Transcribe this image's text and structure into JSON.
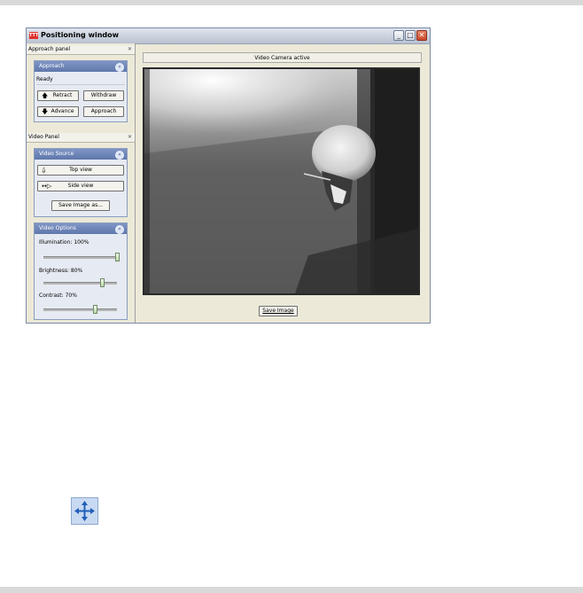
{
  "window": {
    "title": "Positioning window",
    "app_logo": "TTT",
    "minimize_label": "_",
    "maximize_label": "□",
    "close_label": "✕"
  },
  "approach_panel": {
    "title": "Approach panel",
    "close": "✕",
    "group_title": "Approach",
    "collapse": "«",
    "status": "Ready",
    "buttons": {
      "retract": "Retract",
      "withdraw": "Withdraw",
      "advance": "Advance",
      "approach": "Approach"
    }
  },
  "video_panel": {
    "title": "Video Panel",
    "close": "✕",
    "source_group": {
      "title": "Video Source",
      "collapse": "«",
      "top_view": "Top view",
      "side_view": "Side view",
      "save_image_as": "Save Image as..."
    },
    "options_group": {
      "title": "Video Options",
      "collapse": "«",
      "illumination": {
        "label": "Illumination: 100%",
        "value": 100
      },
      "brightness": {
        "label": "Brightness: 80%",
        "value": 80
      },
      "contrast": {
        "label": "Contrast: 70%",
        "value": 70
      }
    }
  },
  "video": {
    "status": "Video Camera active",
    "save_image": "Save Image"
  },
  "icons": {
    "move": "move-arrows-icon"
  }
}
